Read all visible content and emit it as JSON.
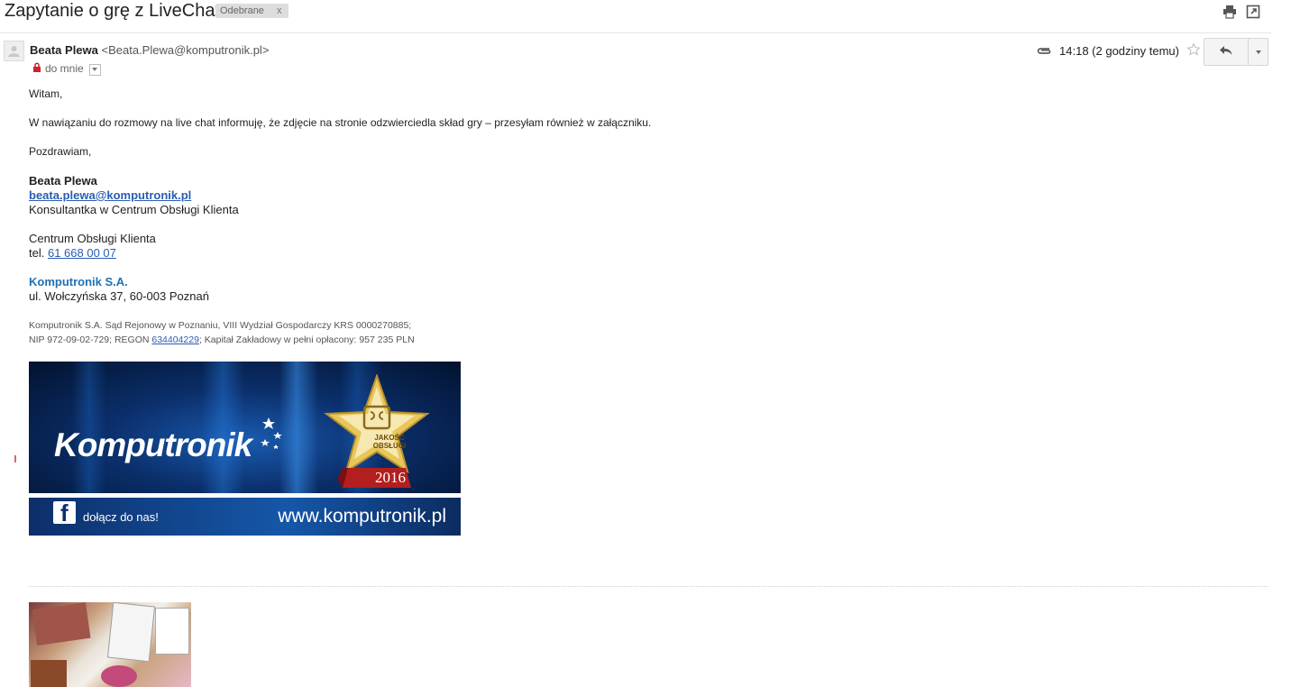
{
  "subject": "Zapytanie o grę z LiveChat'a",
  "label": {
    "text": "Odebrane",
    "close": "x"
  },
  "sender": {
    "name": "Beata Plewa",
    "email": "<Beata.Plewa@komputronik.pl>"
  },
  "recipient": "do mnie",
  "time": "14:18 (2 godziny temu)",
  "body": {
    "greeting": "Witam,",
    "paragraph": "W nawiązaniu do rozmowy na live chat informuję, że zdjęcie na stronie odzwierciedla skład gry – przesyłam również w załączniku.",
    "closing": "Pozdrawiam,"
  },
  "signature": {
    "name": "Beata Plewa",
    "email": "beata.plewa@komputronik.pl",
    "role": "Konsultantka w Centrum Obsługi Klienta",
    "dept": "Centrum Obsługi Klienta",
    "tel_prefix": "tel. ",
    "tel": "61 668 00 07",
    "company": "Komputronik S.A.",
    "address": "ul. Wołczyńska 37, 60-003 Poznań"
  },
  "legal": {
    "line1": "Komputronik S.A. Sąd Rejonowy w Poznaniu, VIII Wydział Gospodarczy KRS 0000270885;",
    "line2_prefix": "NIP 972-09-02-729; REGON ",
    "regon": "634404229",
    "line2_suffix": "; Kapitał Zakładowy w pełni opłacony: 957 235 PLN"
  },
  "banner": {
    "logo": "Komputronik",
    "award_line1": "JAKOŚĆ",
    "award_line2": "OBSŁUGI",
    "award_year": "2016",
    "fb_text": "dołącz do nas!",
    "website": "www.komputronik.pl"
  }
}
